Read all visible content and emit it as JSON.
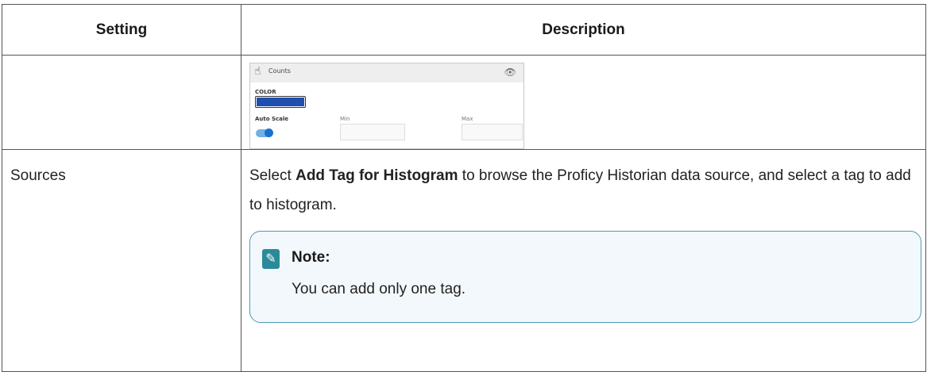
{
  "table": {
    "headers": [
      "Setting",
      "Description"
    ],
    "rows": [
      {
        "setting": "",
        "screenshot": {
          "header_label": "Counts",
          "header_icon": "hand-pointer-icon",
          "visibility_icon": "eye-icon",
          "color_label": "COLOR",
          "swatch_color": "#1f4fb0",
          "auto_scale_label": "Auto Scale",
          "auto_scale_on": true,
          "min_label": "Min",
          "max_label": "Max",
          "min_value": "",
          "max_value": ""
        }
      },
      {
        "setting": "Sources",
        "description_pre": "Select ",
        "description_bold": "Add Tag for Histogram",
        "description_post": " to browse the Proficy Historian data source, and select a tag to add to histogram.",
        "note": {
          "icon": "pencil-icon",
          "title": "Note:",
          "text": "You can add only one tag."
        }
      }
    ]
  },
  "colors": {
    "border": "#555555",
    "note_border": "#4f9bb4",
    "note_bg": "#f3f8fc",
    "note_icon_bg": "#2b8a9a"
  }
}
